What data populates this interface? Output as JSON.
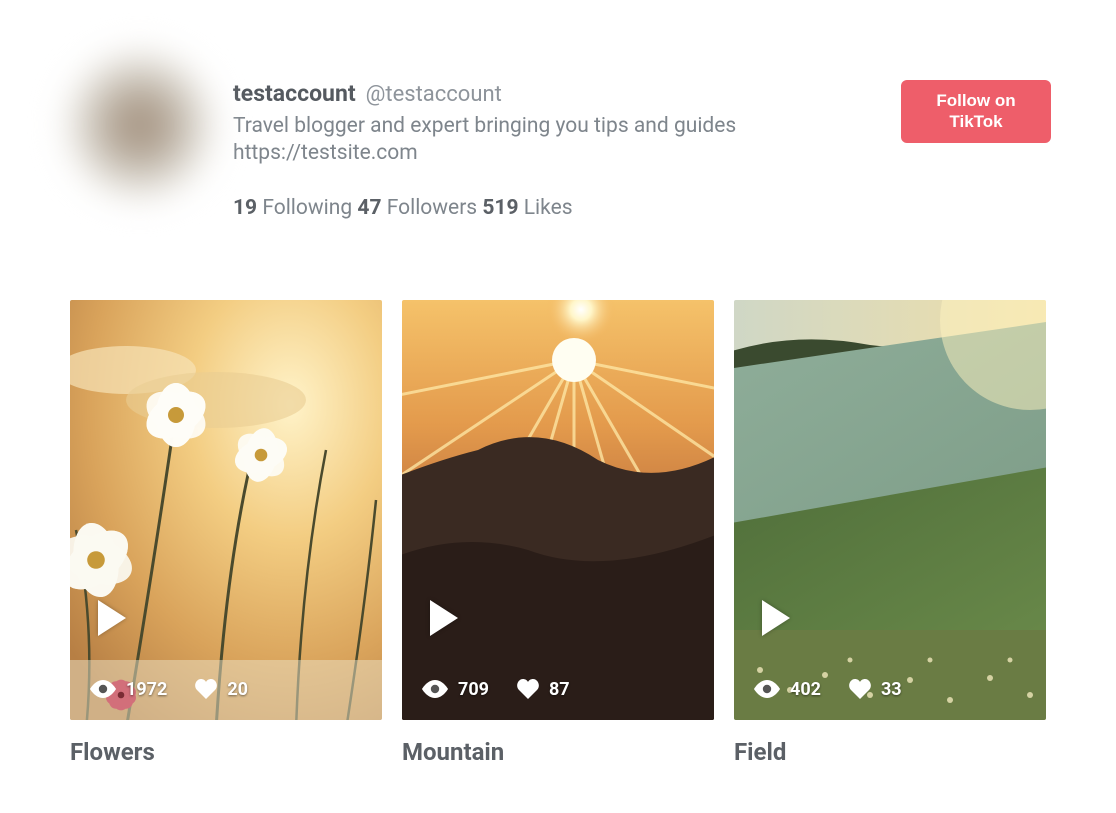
{
  "profile": {
    "display_name": "testaccount",
    "handle": "@testaccount",
    "bio_text": "Travel blogger and expert bringing you tips and guides",
    "bio_link": "https://testsite.com",
    "following_count": "19",
    "following_label": "Following",
    "followers_count": "47",
    "followers_label": "Followers",
    "likes_count": "519",
    "likes_label": "Likes",
    "follow_button": "Follow on TikTok"
  },
  "videos": [
    {
      "title": "Flowers",
      "views": "1972",
      "likes": "20"
    },
    {
      "title": "Mountain",
      "views": "709",
      "likes": "87"
    },
    {
      "title": "Field",
      "views": "402",
      "likes": "33"
    }
  ]
}
